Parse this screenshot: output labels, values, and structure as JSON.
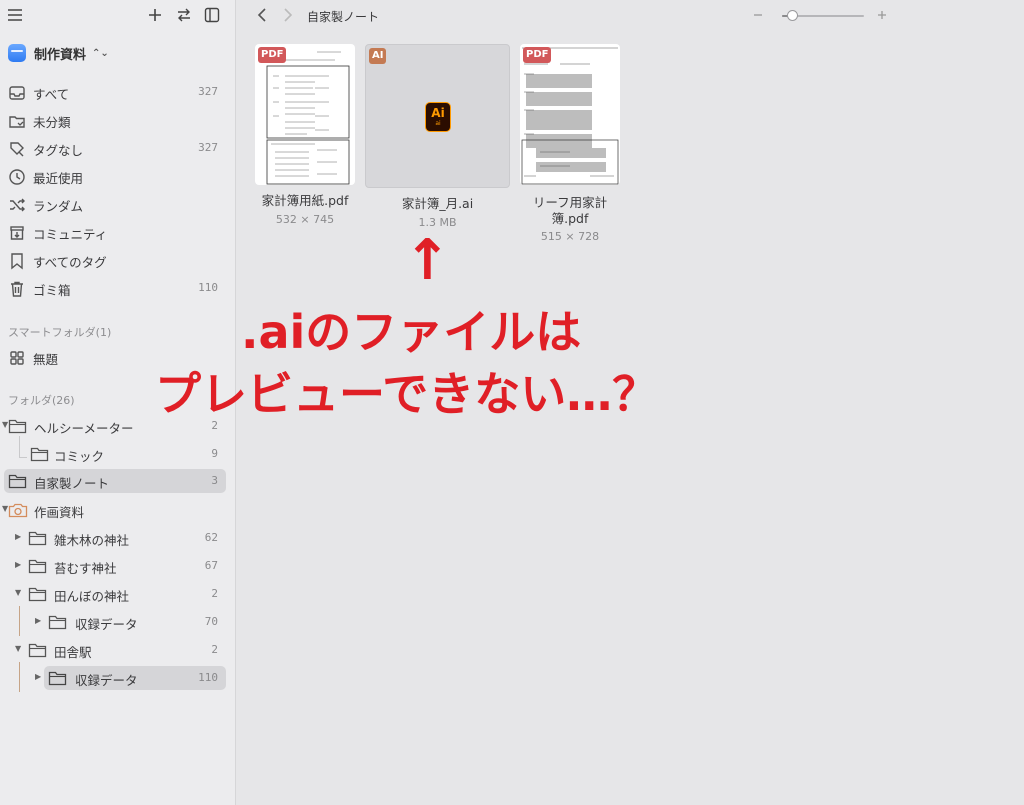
{
  "sidebar": {
    "library": {
      "name": "制作資料"
    },
    "nav": [
      {
        "label": "すべて",
        "count": "327",
        "icon": "inbox-icon"
      },
      {
        "label": "未分類",
        "count": "",
        "icon": "unsorted-folder-icon"
      },
      {
        "label": "タグなし",
        "count": "327",
        "icon": "untagged-icon"
      },
      {
        "label": "最近使用",
        "count": "",
        "icon": "clock-icon"
      },
      {
        "label": "ランダム",
        "count": "",
        "icon": "shuffle-icon"
      },
      {
        "label": "コミュニティ",
        "count": "",
        "icon": "community-icon"
      },
      {
        "label": "すべてのタグ",
        "count": "",
        "icon": "bookmark-icon"
      },
      {
        "label": "ゴミ箱",
        "count": "110",
        "icon": "trash-icon"
      }
    ],
    "smart_section": "スマートフォルダ(1)",
    "smart_items": [
      {
        "label": "無題"
      }
    ],
    "folders_section": "フォルダ(26)",
    "folders": [
      {
        "label": "ヘルシーメーター",
        "count": "2"
      },
      {
        "label": "コミック",
        "count": "9"
      },
      {
        "label": "自家製ノート",
        "count": "3"
      },
      {
        "label": "作画資料",
        "count": ""
      },
      {
        "label": "雑木林の神社",
        "count": "62"
      },
      {
        "label": "苔むす神社",
        "count": "67"
      },
      {
        "label": "田んぼの神社",
        "count": "2"
      },
      {
        "label": "収録データ",
        "count": "70"
      },
      {
        "label": "田舎駅",
        "count": "2"
      },
      {
        "label": "収録データ",
        "count": "110"
      }
    ]
  },
  "toolbar": {
    "breadcrumb": "自家製ノート",
    "zoom_level": 0.12
  },
  "files": [
    {
      "name": "家計簿用紙.pdf",
      "meta": "532 × 745",
      "badge": "PDF"
    },
    {
      "name": "家計簿_月.ai",
      "meta": "1.3 MB",
      "badge": "AI",
      "app_icon_text": "Ai",
      "app_icon_sub": "ai"
    },
    {
      "name": "リーフ用家計簿.pdf",
      "name_line1": "リーフ用家計",
      "name_line2": "簿.pdf",
      "meta": "515 × 728",
      "badge": "PDF"
    }
  ],
  "annotation": {
    "arrow": "↑",
    "line1": ".aiのファイルは",
    "line2": "プレビューできない…？"
  },
  "colors": {
    "annotation": "#e01f26",
    "pdf_badge": "#d2585a",
    "ai_badge": "#c47a53",
    "ai_icon_bg": "#2b0d00",
    "ai_icon_fg": "#ff9a00"
  }
}
